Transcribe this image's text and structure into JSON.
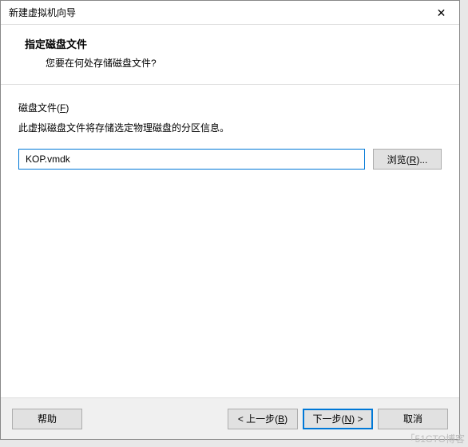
{
  "titlebar": {
    "title": "新建虚拟机向导"
  },
  "header": {
    "title": "指定磁盘文件",
    "subtitle": "您要在何处存储磁盘文件?"
  },
  "body": {
    "group_label_prefix": "磁盘文件(",
    "group_label_key": "F",
    "group_label_suffix": ")",
    "group_desc": "此虚拟磁盘文件将存储选定物理磁盘的分区信息。",
    "file_value": "KOP.vmdk",
    "browse_prefix": "浏览(",
    "browse_key": "R",
    "browse_suffix": ")..."
  },
  "footer": {
    "help": "帮助",
    "back_prefix": "< 上一步(",
    "back_key": "B",
    "back_suffix": ")",
    "next_prefix": "下一步(",
    "next_key": "N",
    "next_suffix": ") >",
    "cancel": "取消"
  },
  "watermark": "「51CTO博客"
}
